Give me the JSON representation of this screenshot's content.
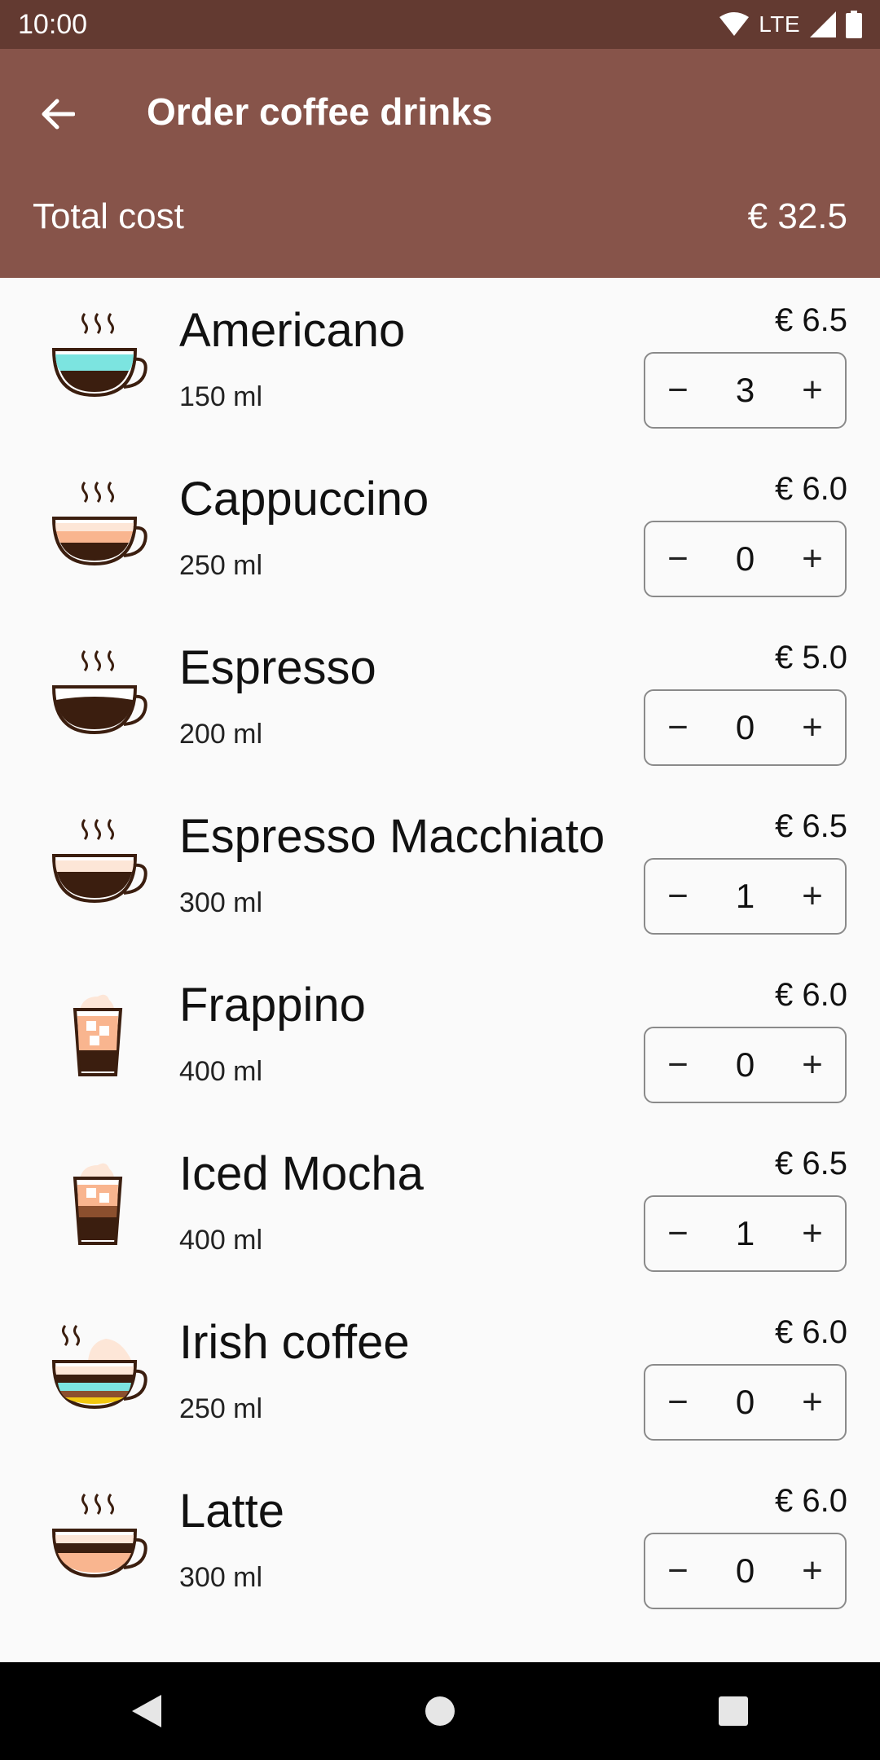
{
  "status_bar": {
    "time": "10:00",
    "network": "LTE"
  },
  "app_bar": {
    "title": "Order coffee drinks",
    "total_label": "Total cost",
    "total_value": "€ 32.5"
  },
  "colors": {
    "status_bar": "#633a31",
    "app_bar": "#87544a",
    "background": "#fafafa"
  },
  "drinks": [
    {
      "name": "Americano",
      "volume": "150 ml",
      "price": "€ 6.5",
      "quantity": "3",
      "icon": "americano-cup-icon"
    },
    {
      "name": "Cappuccino",
      "volume": "250 ml",
      "price": "€ 6.0",
      "quantity": "0",
      "icon": "cappuccino-cup-icon"
    },
    {
      "name": "Espresso",
      "volume": "200 ml",
      "price": "€ 5.0",
      "quantity": "0",
      "icon": "espresso-cup-icon"
    },
    {
      "name": "Espresso Macchiato",
      "volume": "300 ml",
      "price": "€ 6.5",
      "quantity": "1",
      "icon": "macchiato-cup-icon"
    },
    {
      "name": "Frappino",
      "volume": "400 ml",
      "price": "€ 6.0",
      "quantity": "0",
      "icon": "frappino-glass-icon"
    },
    {
      "name": "Iced Mocha",
      "volume": "400 ml",
      "price": "€ 6.5",
      "quantity": "1",
      "icon": "iced-mocha-glass-icon"
    },
    {
      "name": "Irish coffee",
      "volume": "250 ml",
      "price": "€ 6.0",
      "quantity": "0",
      "icon": "irish-coffee-cup-icon"
    },
    {
      "name": "Latte",
      "volume": "300 ml",
      "price": "€ 6.0",
      "quantity": "0",
      "icon": "latte-cup-icon"
    }
  ],
  "stepper": {
    "minus": "−",
    "plus": "+"
  }
}
